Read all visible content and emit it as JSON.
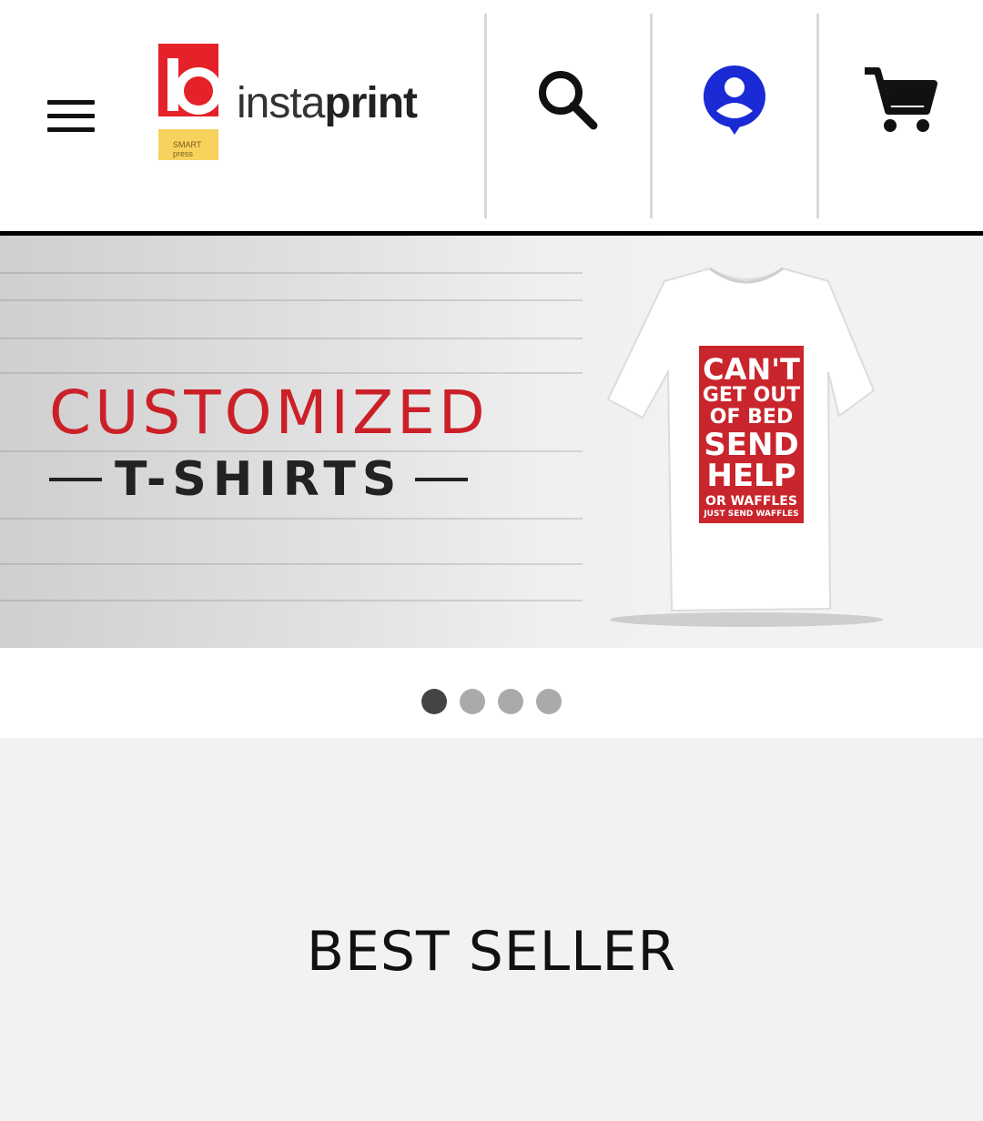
{
  "header": {
    "logo_text_light": "insta",
    "logo_text_bold": "print",
    "logo_sub_text": "SMART press",
    "icons": [
      "menu-icon",
      "search-icon",
      "account-icon",
      "cart-icon"
    ]
  },
  "banner": {
    "title": "CUSTOMIZED",
    "subtitle": "T-SHIRTS",
    "shirt_print": {
      "line1": "CAN'T",
      "line2": "GET OUT",
      "line3": "OF BED",
      "line4": "SEND",
      "line5": "HELP",
      "line6": "OR WAFFLES",
      "line7": "JUST SEND WAFFLES"
    },
    "colors": {
      "accent": "#cb2028",
      "account_icon": "#1a2bd6"
    }
  },
  "carousel": {
    "total": 4,
    "active_index": 0
  },
  "best_seller": {
    "title": "BEST SELLER"
  }
}
